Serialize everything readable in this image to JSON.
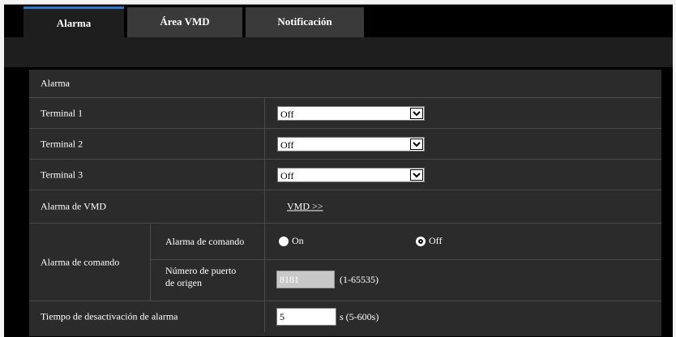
{
  "tabs": [
    {
      "label": "Alarma",
      "active": true
    },
    {
      "label": "Área VMD",
      "active": false
    },
    {
      "label": "Notificación",
      "active": false
    }
  ],
  "section_title": "Alarma",
  "terminals": [
    {
      "label": "Terminal 1",
      "value": "Off"
    },
    {
      "label": "Terminal 2",
      "value": "Off"
    },
    {
      "label": "Terminal 3",
      "value": "Off"
    }
  ],
  "vmd": {
    "label": "Alarma de VMD",
    "link": "VMD >>"
  },
  "command": {
    "group_label": "Alarma de comando",
    "sub_label": "Alarma de comando",
    "option_on": "On",
    "option_off": "Off",
    "selected": "Off",
    "port_label_line1": "Número de puerto",
    "port_label_line2": "de origen",
    "port_value": "8181",
    "port_range": "(1-65535)"
  },
  "deactivation": {
    "label": "Tiempo de desactivación de alarma",
    "value": "5",
    "unit": "s (5-600s)"
  },
  "colors": {
    "active_tab_accent": "#2f75c9",
    "background": "#000000",
    "panel": "#2b2b2b"
  }
}
